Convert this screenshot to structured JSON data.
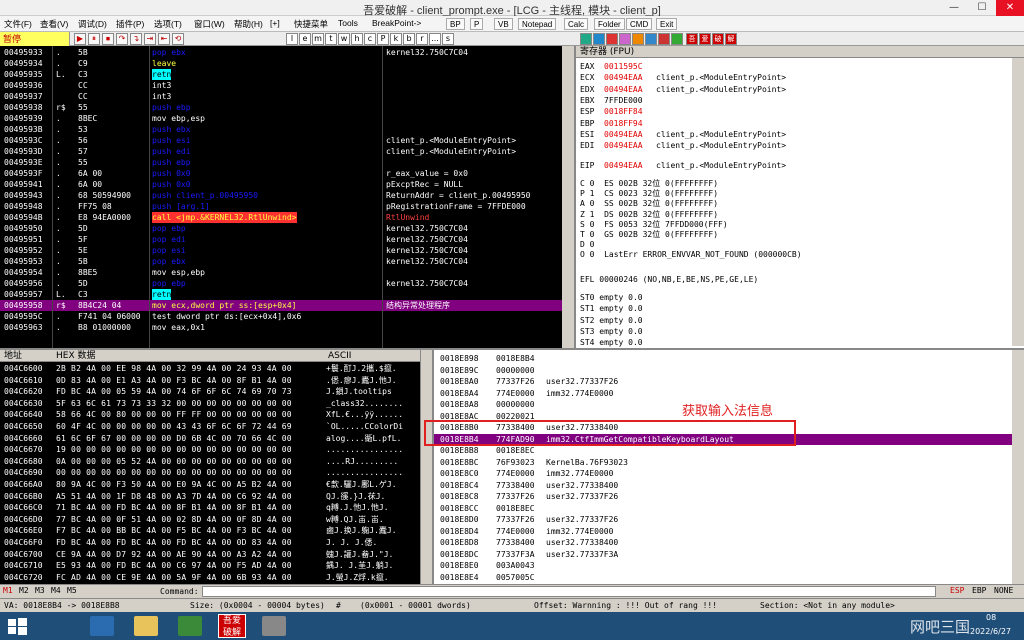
{
  "window": {
    "title": "吾爱破解 - client_prompt.exe - [LCG - 主线程, 模块 - client_p]",
    "minimize": "—",
    "maximize": "☐",
    "close": "✕"
  },
  "menu": {
    "items": [
      "文件(F)",
      "查看(V)",
      "调试(D)",
      "插件(P)",
      "选项(T)",
      "窗口(W)",
      "帮助(H)",
      "[+]",
      "快捷菜单",
      "Tools",
      "BreakPoint->"
    ],
    "buttons": [
      "BP",
      "P",
      "VB",
      "Notepad",
      "Calc",
      "Folder",
      "CMD",
      "Exit"
    ]
  },
  "toolbar": {
    "status": "暂停",
    "letters": [
      "l",
      "e",
      "m",
      "t",
      "w",
      "h",
      "c",
      "P",
      "k",
      "b",
      "r",
      "...",
      "s"
    ],
    "brand": [
      "吾",
      "爱",
      "破",
      "解"
    ]
  },
  "disasm": {
    "rows": [
      {
        "addr": "00495933",
        "mk": ".",
        "hex": "5B",
        "asm": "pop ebx",
        "cls": "pop",
        "cmt": "kernel32.750C7C04"
      },
      {
        "addr": "00495934",
        "mk": ".",
        "hex": "C9",
        "asm": "leave",
        "cls": "yel",
        "cmt": ""
      },
      {
        "addr": "00495935",
        "mk": "L.",
        "hex": "C3",
        "asm": "retn",
        "cls": "retn",
        "cmt": ""
      },
      {
        "addr": "00495936",
        "mk": "",
        "hex": "CC",
        "asm": "int3",
        "cls": "white",
        "cmt": ""
      },
      {
        "addr": "00495937",
        "mk": "",
        "hex": "CC",
        "asm": "int3",
        "cls": "white",
        "cmt": ""
      },
      {
        "addr": "00495938",
        "mk": "r$",
        "hex": "55",
        "asm": "push ebp",
        "cls": "push",
        "cmt": ""
      },
      {
        "addr": "00495939",
        "mk": ".",
        "hex": "8BEC",
        "asm": "mov ebp,esp",
        "cls": "white",
        "cmt": ""
      },
      {
        "addr": "0049593B",
        "mk": ".",
        "hex": "53",
        "asm": "push ebx",
        "cls": "push",
        "cmt": ""
      },
      {
        "addr": "0049593C",
        "mk": ".",
        "hex": "56",
        "asm": "push esi",
        "cls": "push",
        "cmt": "client_p.<ModuleEntryPoint>"
      },
      {
        "addr": "0049593D",
        "mk": ".",
        "hex": "57",
        "asm": "push edi",
        "cls": "push",
        "cmt": "client_p.<ModuleEntryPoint>"
      },
      {
        "addr": "0049593E",
        "mk": ".",
        "hex": "55",
        "asm": "push ebp",
        "cls": "push",
        "cmt": ""
      },
      {
        "addr": "0049593F",
        "mk": ".",
        "hex": "6A 00",
        "asm": "push 0x0",
        "cls": "push",
        "cmt": "r_eax_value = 0x0"
      },
      {
        "addr": "00495941",
        "mk": ".",
        "hex": "6A 00",
        "asm": "push 0x0",
        "cls": "push",
        "cmt": "pExcptRec = NULL"
      },
      {
        "addr": "00495943",
        "mk": ".",
        "hex": "68 50594900",
        "asm": "push client_p.00495950",
        "cls": "push",
        "cmt": "ReturnAddr = client_p.00495950"
      },
      {
        "addr": "00495948",
        "mk": ".",
        "hex": "FF75 08",
        "asm": "push [arg.1]",
        "cls": "push",
        "cmt": "pRegistrationFrame = 7FFDE000"
      },
      {
        "addr": "0049594B",
        "mk": ".",
        "hex": "E8 94EA0000",
        "asm": "call <jmp.&KERNEL32.RtlUnwind>",
        "cls": "call",
        "cmt": "RtlUnwind"
      },
      {
        "addr": "00495950",
        "mk": ".",
        "hex": "5D",
        "asm": "pop ebp",
        "cls": "pop",
        "cmt": "kernel32.750C7C04"
      },
      {
        "addr": "00495951",
        "mk": ".",
        "hex": "5F",
        "asm": "pop edi",
        "cls": "pop",
        "cmt": "kernel32.750C7C04"
      },
      {
        "addr": "00495952",
        "mk": ".",
        "hex": "5E",
        "asm": "pop esi",
        "cls": "pop",
        "cmt": "kernel32.750C7C04"
      },
      {
        "addr": "00495953",
        "mk": ".",
        "hex": "5B",
        "asm": "pop ebx",
        "cls": "pop",
        "cmt": "kernel32.750C7C04"
      },
      {
        "addr": "00495954",
        "mk": ".",
        "hex": "8BE5",
        "asm": "mov esp,ebp",
        "cls": "white",
        "cmt": ""
      },
      {
        "addr": "00495956",
        "mk": ".",
        "hex": "5D",
        "asm": "pop ebp",
        "cls": "pop",
        "cmt": "kernel32.750C7C04"
      },
      {
        "addr": "00495957",
        "mk": "L.",
        "hex": "C3",
        "asm": "retn",
        "cls": "retn",
        "cmt": ""
      },
      {
        "addr": "00495958",
        "mk": "r$",
        "hex": "8B4C24 04",
        "asm": "mov ecx,dword ptr ss:[esp+0x4]",
        "cls": "sel",
        "cmt": "结构异常处理程序"
      },
      {
        "addr": "0049595C",
        "mk": ".",
        "hex": "F741 04 06000",
        "asm": "test dword ptr ds:[ecx+0x4],0x6",
        "cls": "white",
        "cmt": ""
      },
      {
        "addr": "00495963",
        "mk": ".",
        "hex": "B8 01000000",
        "asm": "mov eax,0x1",
        "cls": "white",
        "cmt": ""
      }
    ]
  },
  "registers": {
    "header": "寄存器 (FPU)",
    "lines": [
      {
        "name": "EAX",
        "val": "0011595C",
        "cmt": "",
        "red": true
      },
      {
        "name": "ECX",
        "val": "00494EAA",
        "cmt": "client_p.<ModuleEntryPoint>",
        "red": true
      },
      {
        "name": "EDX",
        "val": "00494EAA",
        "cmt": "client_p.<ModuleEntryPoint>",
        "red": true
      },
      {
        "name": "EBX",
        "val": "7FFDE000",
        "cmt": "",
        "red": false
      },
      {
        "name": "ESP",
        "val": "0018FF84",
        "cmt": "",
        "red": true
      },
      {
        "name": "EBP",
        "val": "0018FF94",
        "cmt": "",
        "red": true
      },
      {
        "name": "ESI",
        "val": "00494EAA",
        "cmt": "client_p.<ModuleEntryPoint>",
        "red": true
      },
      {
        "name": "EDI",
        "val": "00494EAA",
        "cmt": "client_p.<ModuleEntryPoint>",
        "red": true
      },
      {
        "name": "EIP",
        "val": "00494EAA",
        "cmt": "client_p.<ModuleEntryPoint>",
        "red": true
      }
    ],
    "flags": [
      "C 0  ES 002B 32位 0(FFFFFFFF)",
      "P 1  CS 0023 32位 0(FFFFFFFF)",
      "A 0  SS 002B 32位 0(FFFFFFFF)",
      "Z 1  DS 002B 32位 0(FFFFFFFF)",
      "S 0  FS 0053 32位 7FFDD000(FFF)",
      "T 0  GS 002B 32位 0(FFFFFFFF)",
      "D 0",
      "O 0  LastErr ERROR_ENVVAR_NOT_FOUND (000000CB)"
    ],
    "efl": "EFL 00000246 (NO,NB,E,BE,NS,PE,GE,LE)",
    "fpu": [
      "ST0 empty 0.0",
      "ST1 empty 0.0",
      "ST2 empty 0.0",
      "ST3 empty 0.0",
      "ST4 empty 0.0"
    ]
  },
  "dump": {
    "hdr_addr": "地址",
    "hdr_hex": "HEX 数据",
    "hdr_ascii": "ASCII",
    "rows": [
      {
        "addr": "004C6600",
        "hex": "2B B2 4A 00 EE 98 4A 00 32 99 4A 00 24 93 4A 00",
        "ascii": "+鬟.酊J.2攜.$攛."
      },
      {
        "addr": "004C6610",
        "hex": "0D 83 4A 00 E1 A3 4A 00 F3 BC 4A 00 8F B1 4A 00",
        "ascii": ".僁.瘳J.蠹J.忚J."
      },
      {
        "addr": "004C6620",
        "hex": "FD BC 4A 00 05 59 4A 00 74 6F 6F 6C 74 69 70 73",
        "ascii": "J.鎻J.tooltips"
      },
      {
        "addr": "004C6630",
        "hex": "5F 63 6C 61 73 73 33 32 00 00 00 00 00 00 00 00",
        "ascii": "_class32........"
      },
      {
        "addr": "004C6640",
        "hex": "58 66 4C 00 80 00 00 00 FF FF 00 00 00 00 00 00",
        "ascii": "XfL.€...ÿÿ......"
      },
      {
        "addr": "004C6650",
        "hex": "60 4F 4C 00 00 00 00 00 43 43 6F 6C 6F 72 44 69",
        "ascii": "`OL.....CColorDi"
      },
      {
        "addr": "004C6660",
        "hex": "61 6C 6F 67 00 00 00 00 D0 6B 4C 00 70 66 4C 00",
        "ascii": "alog....衚L.pfL."
      },
      {
        "addr": "004C6670",
        "hex": "19 00 00 00 00 00 00 00 00 00 00 00 00 00 00 00",
        "ascii": "................"
      },
      {
        "addr": "004C6680",
        "hex": "0A 00 00 00 05 52 4A 00 00 00 00 00 00 00 00 00",
        "ascii": "....RJ........."
      },
      {
        "addr": "004C6690",
        "hex": "00 00 00 00 00 00 00 00 00 00 00 00 00 00 00 00",
        "ascii": "................"
      },
      {
        "addr": "004C66A0",
        "hex": "80 9A 4C 00 F3 50 4A 00 E0 9A 4C 00 A5 B2 4A 00",
        "ascii": "€歀.驪J.鄽L.ゲJ."
      },
      {
        "addr": "004C66B0",
        "hex": "A5 51 4A 00 1F D8 48 00 A3 7D 4A 00 C6 92 4A 00",
        "ascii": "QJ.豀.}J.茠J."
      },
      {
        "addr": "004C66C0",
        "hex": "71 BC 4A 00 FD BC 4A 00 8F B1 4A 00 8F B1 4A 00",
        "ascii": "q糐.J.忚J.忚J."
      },
      {
        "addr": "004C66D0",
        "hex": "77 BC 4A 00 0F 51 4A 00 02 8D 4A 00 0F 8D 4A 00",
        "ascii": "w糐.QJ.峀.峀."
      },
      {
        "addr": "004C66E0",
        "hex": "F7 BC 4A 00 BB BC 4A 00 F5 BC 4A 00 F3 BC 4A 00",
        "ascii": "鹵J.换J.躹J.蠹J."
      },
      {
        "addr": "004C66F0",
        "hex": "FD BC 4A 00 FD BC 4A 00 FD BC 4A 00 0D 83 4A 00",
        "ascii": "J. J. J.僁."
      },
      {
        "addr": "004C6700",
        "hex": "CE 9A 4A 00 D7 92 4A 00 AE 90 4A 00 A3 A2 4A 00",
        "ascii": "螝J.讙J.畚J.\"J."
      },
      {
        "addr": "004C6710",
        "hex": "E5 93 4A 00 FD BC 4A 00 C6 97 4A 00 F5 AD 4A 00",
        "ascii": "鍝J. J.茥J.躺J."
      },
      {
        "addr": "004C6720",
        "hex": "FC AD 4A 00 CE 9E 4A 00 5A 9F 4A 00 6B 93 4A 00",
        "ascii": "J.螢J.Z烰.k攛."
      }
    ]
  },
  "stack": {
    "rows": [
      {
        "addr": "0018E898",
        "val": "0018E8B4",
        "cmt": ""
      },
      {
        "addr": "0018E89C",
        "val": "00000000",
        "cmt": ""
      },
      {
        "addr": "0018E8A0",
        "val": "77337F26",
        "cmt": "user32.77337F26"
      },
      {
        "addr": "0018E8A4",
        "val": "774E0000",
        "cmt": "imm32.774E0000"
      },
      {
        "addr": "0018E8A8",
        "val": "00000000",
        "cmt": ""
      },
      {
        "addr": "0018E8AC",
        "val": "00220021",
        "cmt": ""
      },
      {
        "addr": "0018E8B0",
        "val": "77338400",
        "cmt": "user32.77338400"
      },
      {
        "addr": "0018E8B4",
        "val": "774FAD90",
        "cmt": "imm32.CtfImmGetCompatibleKeyboardLayout"
      },
      {
        "addr": "0018E8B8",
        "val": "0018E8EC",
        "cmt": ""
      },
      {
        "addr": "0018E8BC",
        "val": "76F93023",
        "cmt": "KernelBa.76F93023"
      },
      {
        "addr": "0018E8C0",
        "val": "774E0000",
        "cmt": "imm32.774E0000"
      },
      {
        "addr": "0018E8C4",
        "val": "77338400",
        "cmt": "user32.77338400"
      },
      {
        "addr": "0018E8C8",
        "val": "77337F26",
        "cmt": "user32.77337F26"
      },
      {
        "addr": "0018E8CC",
        "val": "0018E8EC",
        "cmt": ""
      },
      {
        "addr": "0018E8D0",
        "val": "77337F26",
        "cmt": "user32.77337F26"
      },
      {
        "addr": "0018E8D4",
        "val": "774E0000",
        "cmt": "imm32.774E0000"
      },
      {
        "addr": "0018E8D8",
        "val": "77338400",
        "cmt": "user32.77338400"
      },
      {
        "addr": "0018E8DC",
        "val": "77337F3A",
        "cmt": "user32.77337F3A"
      },
      {
        "addr": "0018E8E0",
        "val": "003A0043",
        "cmt": ""
      },
      {
        "addr": "0018E8E4",
        "val": "0057005C",
        "cmt": ""
      }
    ],
    "annotation": "获取输入法信息"
  },
  "cmdbar": {
    "tabs": [
      "M1",
      "M2",
      "M3",
      "M4",
      "M5"
    ],
    "label": "Command:",
    "right": [
      "ESP",
      "EBP",
      "NONE"
    ]
  },
  "statusbar": {
    "va": "VA: 0018E8B4 -> 0018E8B8",
    "size": "Size: (0x0004 - 00004 bytes)",
    "hash": "#",
    "count": "(0x0001 - 00001 dwords)",
    "offset": "Offset: Warnning : !!! Out of rang !!!",
    "section": "Section: <Not in any module>"
  },
  "taskbar": {
    "clock_time": "08",
    "clock_date": "2022/6/27",
    "watermark": "网吧三国",
    "app_label": "吾爱破解"
  }
}
